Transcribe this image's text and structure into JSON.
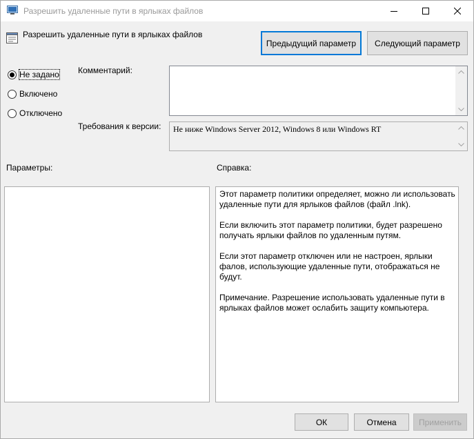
{
  "window": {
    "title": "Разрешить удаленные пути в ярлыках файлов",
    "policy_title": "Разрешить удаленные пути в ярлыках файлов"
  },
  "nav": {
    "prev_label": "Предыдущий параметр",
    "next_label": "Следующий параметр"
  },
  "state": {
    "options": [
      {
        "label": "Не задано",
        "selected": true
      },
      {
        "label": "Включено",
        "selected": false
      },
      {
        "label": "Отключено",
        "selected": false
      }
    ]
  },
  "comment": {
    "label": "Комментарий:",
    "value": ""
  },
  "requirements": {
    "label": "Требования к версии:",
    "value": "Не ниже Windows Server 2012, Windows 8 или Windows RT"
  },
  "params": {
    "label": "Параметры:"
  },
  "help": {
    "label": "Справка:",
    "paragraphs": [
      "Этот параметр политики определяет, можно ли использовать удаленные пути для ярлыков файлов (файл .lnk).",
      "Если включить этот параметр политики, будет разрешено получать ярлыки файлов по удаленным путям.",
      "Если этот параметр отключен или не настроен, ярлыки фалов, использующие удаленные пути, отображаться не будут.",
      "Примечание. Разрешение использовать удаленные пути в ярлыках файлов может ослабить защиту компьютера."
    ]
  },
  "footer": {
    "ok_label": "ОК",
    "cancel_label": "Отмена",
    "apply_label": "Применить"
  }
}
